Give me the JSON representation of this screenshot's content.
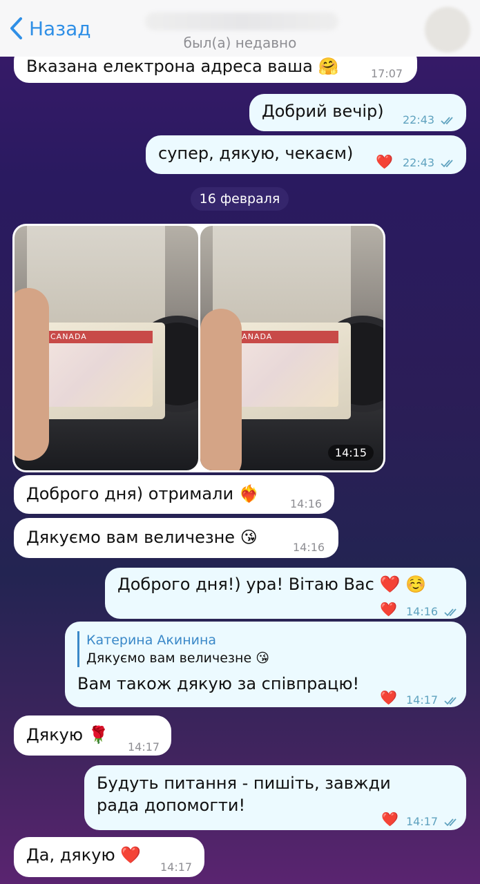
{
  "header": {
    "back_label": "Назад",
    "status": "был(а) недавно"
  },
  "messages": {
    "m1": {
      "text": "Вказана електрона адреса ваша",
      "emoji": "🤗",
      "time": "17:07"
    },
    "m2": {
      "text": "Добрий вечір)",
      "time": "22:43"
    },
    "m3": {
      "text": "супер, дякую, чекаєм)",
      "reaction": "❤️",
      "time": "22:43"
    },
    "date_divider": "16 февраля",
    "photo_time": "14:15",
    "photo_labels": {
      "left": "CANADA",
      "right": "CANADA"
    },
    "m4": {
      "text": "Доброго дня) отримали",
      "emoji": "❤️‍🔥",
      "time": "14:16"
    },
    "m5": {
      "text": "Дякуємо вам величезне",
      "emoji": "😘",
      "time": "14:16"
    },
    "m6": {
      "text": "Доброго дня!) ура! Вітаю Вас",
      "emoji": "❤️ ☺️",
      "reaction": "❤️",
      "time": "14:16"
    },
    "m7": {
      "reply_name": "Катерина Акинина",
      "reply_text": "Дякуємо вам величезне",
      "reply_emoji": "😘",
      "text": "Вам також дякую за співпрацю!",
      "reaction": "❤️",
      "time": "14:17"
    },
    "m8": {
      "text": "Дякую",
      "emoji": "🌹",
      "time": "14:17"
    },
    "m9": {
      "text": "Будуть питання - пишіть, завжди рада допомогти!",
      "reaction": "❤️",
      "time": "14:17"
    },
    "m10": {
      "text": "Да, дякую",
      "emoji": "❤️",
      "time": "14:17"
    }
  },
  "colors": {
    "accent": "#2f8fe6",
    "outgoing_bubble": "#ecfaff",
    "incoming_bubble": "#ffffff",
    "heart": "#e01d2a"
  }
}
